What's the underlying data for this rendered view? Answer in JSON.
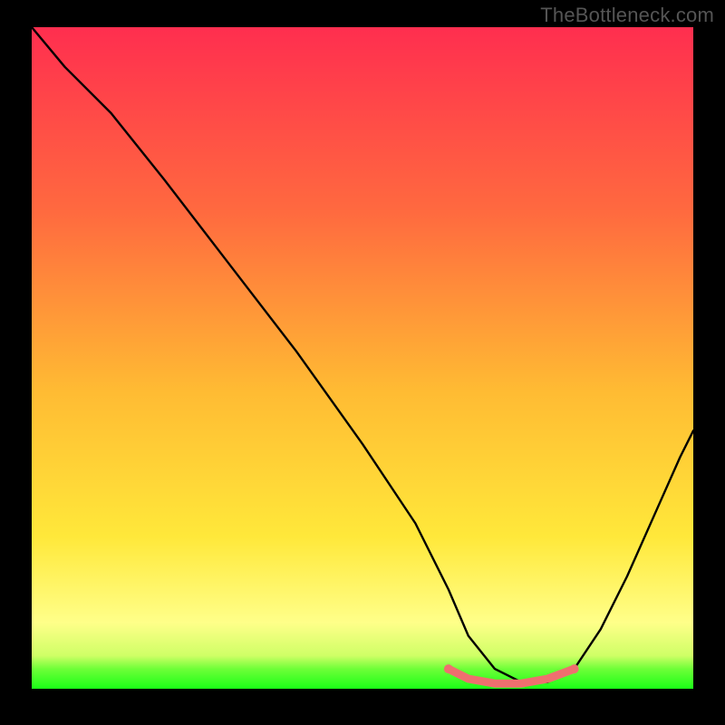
{
  "watermark": "TheBottleneck.com",
  "chart_data": {
    "type": "line",
    "title": "",
    "xlabel": "",
    "ylabel": "",
    "xlim": [
      0,
      100
    ],
    "ylim": [
      0,
      100
    ],
    "grid": false,
    "legend": false,
    "background_gradient": {
      "top": "#ff2e4f",
      "mid": "#ffbb33",
      "bottom_highlight": "#ffff89",
      "green1": "#6eff38",
      "green2": "#1bff17"
    },
    "series": [
      {
        "name": "curve",
        "color": "#000000",
        "x": [
          0,
          5,
          12,
          20,
          30,
          40,
          50,
          58,
          63,
          66,
          70,
          74,
          78,
          82,
          86,
          90,
          94,
          98,
          100
        ],
        "y": [
          100,
          94,
          87,
          77,
          64,
          51,
          37,
          25,
          15,
          8,
          3,
          1,
          1,
          3,
          9,
          17,
          26,
          35,
          39
        ]
      },
      {
        "name": "trough-highlight",
        "color": "#ef6f6f",
        "thick": true,
        "x": [
          63,
          66,
          70,
          74,
          78,
          82
        ],
        "y": [
          3,
          1.5,
          0.8,
          0.8,
          1.5,
          3
        ]
      }
    ]
  }
}
